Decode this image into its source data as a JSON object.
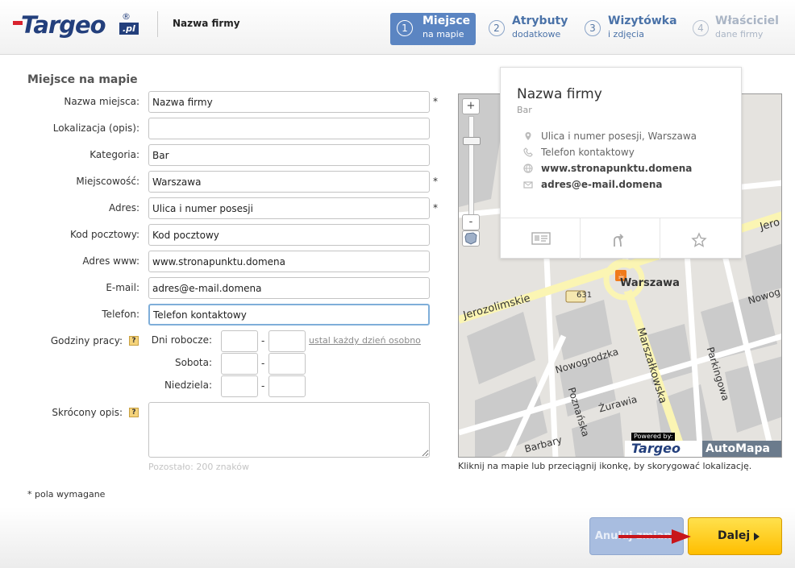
{
  "header": {
    "logo_text": "Targeo",
    "logo_reg": "®",
    "logo_domain": ".pl",
    "company_name": "Nazwa firmy",
    "steps": [
      {
        "num": "1",
        "title": "Miejsce",
        "subtitle": "na mapie",
        "state": "active"
      },
      {
        "num": "2",
        "title": "Atrybuty",
        "subtitle": "dodatkowe",
        "state": "normal"
      },
      {
        "num": "3",
        "title": "Wizytówka",
        "subtitle": "i zdjęcia",
        "state": "normal"
      },
      {
        "num": "4",
        "title": "Właściciel",
        "subtitle": "dane firmy",
        "state": "disabled"
      }
    ]
  },
  "form": {
    "section_title": "Miejsce na mapie",
    "required_mark": "*",
    "fields": [
      {
        "label": "Nazwa miejsca:",
        "value": "Nazwa firmy",
        "required": true
      },
      {
        "label": "Lokalizacja (opis):",
        "value": "",
        "required": false
      },
      {
        "label": "Kategoria:",
        "value": "Bar",
        "required": false
      },
      {
        "label": "Miejscowość:",
        "value": "Warszawa",
        "required": true
      },
      {
        "label": "Adres:",
        "value": "Ulica i numer posesji",
        "required": true
      },
      {
        "label": "Kod pocztowy:",
        "value": "Kod pocztowy",
        "required": false
      },
      {
        "label": "Adres www:",
        "value": "www.stronapunktu.domena",
        "required": false
      },
      {
        "label": "E-mail:",
        "value": "adres@e-mail.domena",
        "required": false
      },
      {
        "label": "Telefon:",
        "value": "Telefon kontaktowy",
        "required": false
      }
    ],
    "hours": {
      "label": "Godziny pracy:",
      "help": "?",
      "weekdays_label": "Dni robocze:",
      "saturday_label": "Sobota:",
      "sunday_label": "Niedziela:",
      "dash": "-",
      "each_day_link": "ustal każdy dzień osobno"
    },
    "description": {
      "label": "Skrócony opis:",
      "help": "?",
      "chars_left": "Pozostało: 200 znaków"
    },
    "required_note": "* pola wymagane"
  },
  "map": {
    "hint": "Kliknij na mapie lub przeciągnij ikonkę, by skorygować lokalizację.",
    "zoom_in": "+",
    "zoom_out": "-",
    "popup": {
      "title": "Nazwa firmy",
      "category": "Bar",
      "address": "Ulica i numer posesji, Warszawa",
      "phone": "Telefon kontaktowy",
      "www": "www.stronapunktu.domena",
      "email": "adres@e-mail.domena"
    },
    "labels": {
      "city": "Warszawa",
      "road_number": "631",
      "jerozolimskie": "Jerozolimskie",
      "jero_right": "Jero",
      "nowogrodzka": "Nowogrodzka",
      "nowog_right": "Nowog",
      "marszalkowska": "Marszałkowska",
      "parkingowa": "Parkingowa",
      "poznanska": "Poznańska",
      "zurawia": "Żurawia",
      "barbary": "Barbary",
      "powered_by": "Powered by:",
      "brand_targeo": "Targeo",
      "brand_automapa": "AutoMapa"
    },
    "colors": {
      "road": "#ffffff",
      "main_road": "#fbf5b3",
      "block": "#c9c9c9",
      "ground": "#e5e3df",
      "pin": "#f07a1c"
    }
  },
  "buttons": {
    "cancel": "Anuluj zmiany",
    "next": "Dalej"
  }
}
